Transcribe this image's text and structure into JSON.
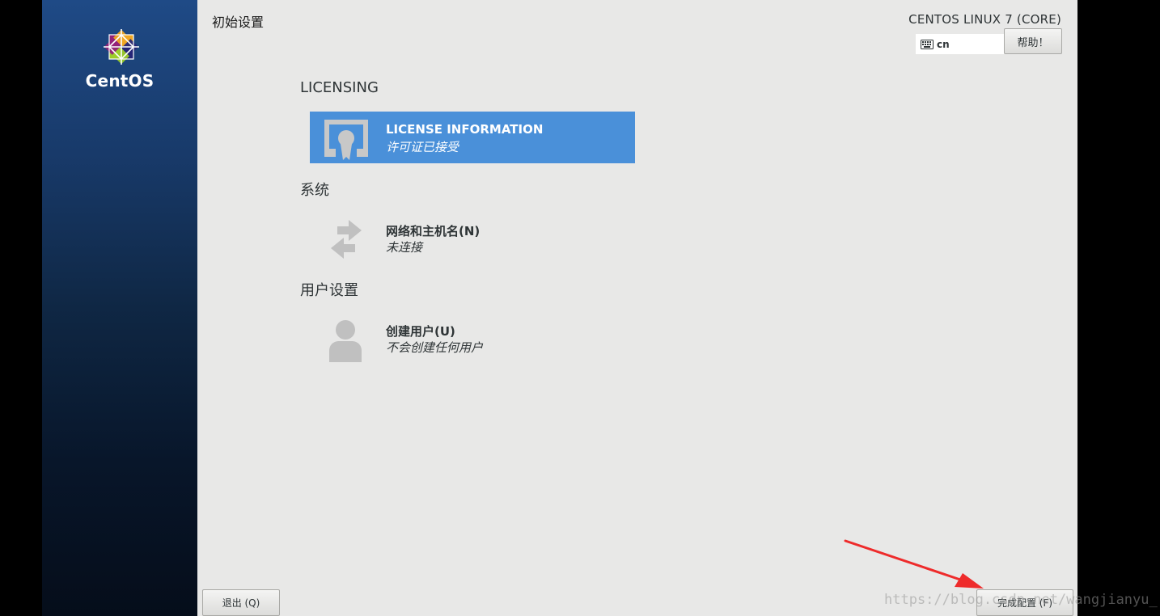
{
  "sidebar": {
    "brand": "CentOS"
  },
  "header": {
    "title": "初始设置",
    "os_name": "CENTOS LINUX 7 (CORE)",
    "keyboard_layout": "cn",
    "help_label": "帮助！"
  },
  "sections": [
    {
      "heading": "LICENSING",
      "spokes": [
        {
          "title": "LICENSE INFORMATION",
          "status": "许可证已接受",
          "selected": true,
          "icon": "license-icon"
        }
      ]
    },
    {
      "heading": "系统",
      "spokes": [
        {
          "title": "网络和主机名(N)",
          "status": "未连接",
          "selected": false,
          "icon": "network-arrows-icon"
        }
      ]
    },
    {
      "heading": "用户设置",
      "spokes": [
        {
          "title": "创建用户(U)",
          "status": "不会创建任何用户",
          "selected": false,
          "icon": "user-icon"
        }
      ]
    }
  ],
  "footer": {
    "quit_label": "退出 (Q)",
    "finish_label": "完成配置 (F)"
  },
  "watermark": "https://blog.csdn.net/wangjianyu_",
  "colors": {
    "selected_spoke": "#4a90d9",
    "main_bg": "#e8e8e7",
    "annotation_arrow": "#ee2b2b"
  }
}
